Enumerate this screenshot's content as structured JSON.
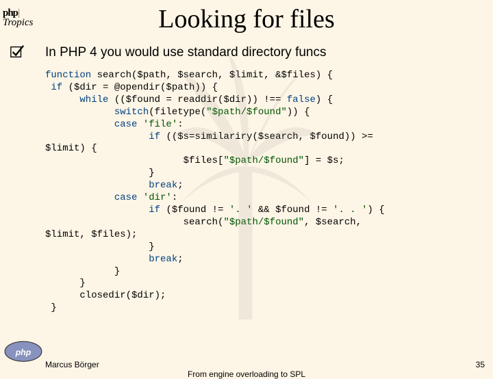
{
  "logo": {
    "php": "php",
    "bar": "|",
    "tropics": "Tropics"
  },
  "title": "Looking for files",
  "bullet": "In PHP 4 you would use standard directory funcs",
  "code": {
    "l1a": "function ",
    "l1b": "search($path, $search, $limit, &$files) {",
    "l2a": " if ",
    "l2b": "($dir = @opendir($path)) {",
    "l3a": "      while ",
    "l3b": "(($found = readdir($dir)) !== ",
    "l3c": "false",
    "l3d": ") {",
    "l4a": "            switch",
    "l4b": "(filetype(",
    "l4c": "\"$path/$found\"",
    "l4d": ")) {",
    "l5a": "            case ",
    "l5b": "'file'",
    "l5c": ":",
    "l6a": "                  if ",
    "l6b": "(($s=similariry($search, $found)) >= ",
    "l7": "$limit) {",
    "l8a": "                        $files[",
    "l8b": "\"$path/$found\"",
    "l8c": "] = $s;",
    "l9": "                  }",
    "l10a": "                  break",
    "l10b": ";",
    "l11a": "            case ",
    "l11b": "'dir'",
    "l11c": ":",
    "l12a": "                  if ",
    "l12b": "($found != ",
    "l12c": "'. '",
    "l12d": " && $found != ",
    "l12e": "'. . '",
    "l12f": ") {",
    "l13a": "                        search(",
    "l13b": "\"$path/$found\"",
    "l13c": ", $search, ",
    "l14": "$limit, $files);",
    "l15": "                  }",
    "l16a": "                  break",
    "l16b": ";",
    "l17": "            }",
    "l18": "      }",
    "l19": "      closedir($dir);",
    "l20": " }"
  },
  "footer": {
    "author": "Marcus Börger",
    "title": "From engine overloading to SPL",
    "page": "35"
  }
}
